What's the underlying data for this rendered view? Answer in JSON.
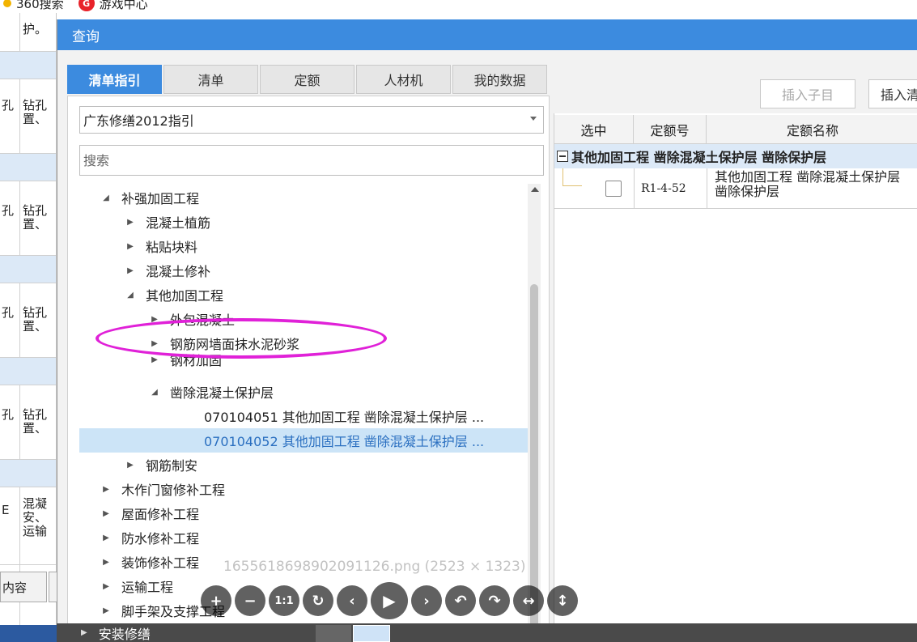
{
  "browser": {
    "bookmarks": [
      {
        "label": "360搜索",
        "icon": "360-search-icon"
      },
      {
        "label": "游戏中心",
        "icon": "game-center-icon"
      }
    ]
  },
  "background_sheet": {
    "rows": [
      {
        "c1": "",
        "c2": "护。"
      },
      {
        "c1": "孔",
        "c2": "钻孔\n置、"
      },
      {
        "c1": "孔",
        "c2": "钻孔\n置、"
      },
      {
        "c1": "孔",
        "c2": "钻孔\n置、"
      },
      {
        "c1": "孔",
        "c2": "钻孔\n置、"
      },
      {
        "c1": "E",
        "c2": "混凝\n安、\n运输"
      }
    ],
    "tab_label": "内容"
  },
  "dialog": {
    "title": "查询",
    "tabs": [
      {
        "label": "清单指引",
        "active": true
      },
      {
        "label": "清单",
        "active": false
      },
      {
        "label": "定额",
        "active": false
      },
      {
        "label": "人材机",
        "active": false
      },
      {
        "label": "我的数据",
        "active": false
      }
    ],
    "guide_select_value": "广东修缮2012指引",
    "search_placeholder": "搜索",
    "tree": [
      {
        "label": "补强加固工程",
        "expanded": true
      },
      {
        "label": "混凝土植筋",
        "expanded": false
      },
      {
        "label": "粘贴块料",
        "expanded": false
      },
      {
        "label": "混凝土修补",
        "expanded": false
      },
      {
        "label": "其他加固工程",
        "expanded": true
      },
      {
        "label": "外包混凝土",
        "expanded": false
      },
      {
        "label": "钢筋网墙面抹水泥砂浆",
        "expanded": false
      },
      {
        "label": "钢材加固",
        "expanded": false
      },
      {
        "label": "凿除混凝土保护层",
        "expanded": true
      },
      {
        "label": "070104051  其他加固工程 凿除混凝土保护层 ...",
        "leaf": true
      },
      {
        "label": "070104052  其他加固工程 凿除混凝土保护层 ...",
        "leaf": true,
        "selected": true
      },
      {
        "label": "钢筋制安",
        "expanded": false
      },
      {
        "label": "木作门窗修补工程",
        "expanded": false
      },
      {
        "label": "屋面修补工程",
        "expanded": false
      },
      {
        "label": "防水修补工程",
        "expanded": false
      },
      {
        "label": "装饰修补工程",
        "expanded": false
      },
      {
        "label": "运输工程",
        "expanded": false
      },
      {
        "label": "脚手架及支撑工程",
        "expanded": false
      },
      {
        "label": "安装修缮",
        "expanded": false
      }
    ],
    "buttons": {
      "insert_child": "插入子目",
      "insert_list": "插入清"
    },
    "table": {
      "headers": [
        "选中",
        "定额号",
        "定额名称"
      ],
      "group_title": "其他加固工程 凿除混凝土保护层 凿除保护层",
      "rows": [
        {
          "code": "R1-4-52",
          "name_line1": "其他加固工程 凿除混凝土保护层",
          "name_line2": "凿除保护层",
          "checked": false
        }
      ]
    }
  },
  "viewer": {
    "caption": "1655618698902091126.png (2523 × 1323)",
    "controls": [
      {
        "name": "zoom-in-icon",
        "glyph": "+"
      },
      {
        "name": "zoom-out-icon",
        "glyph": "−"
      },
      {
        "name": "actual-size-icon",
        "glyph": "1:1"
      },
      {
        "name": "reset-icon",
        "glyph": "↻"
      },
      {
        "name": "prev-icon",
        "glyph": "‹"
      },
      {
        "name": "play-icon",
        "glyph": "▶"
      },
      {
        "name": "next-icon",
        "glyph": "›"
      },
      {
        "name": "rotate-left-icon",
        "glyph": "↶"
      },
      {
        "name": "rotate-right-icon",
        "glyph": "↷"
      },
      {
        "name": "flip-horizontal-icon",
        "glyph": "↔"
      },
      {
        "name": "flip-vertical-icon",
        "glyph": "↕"
      }
    ]
  },
  "colors": {
    "accent": "#3c8bdf",
    "selection": "#cce4f7",
    "highlight_ellipse": "#e021d8"
  }
}
